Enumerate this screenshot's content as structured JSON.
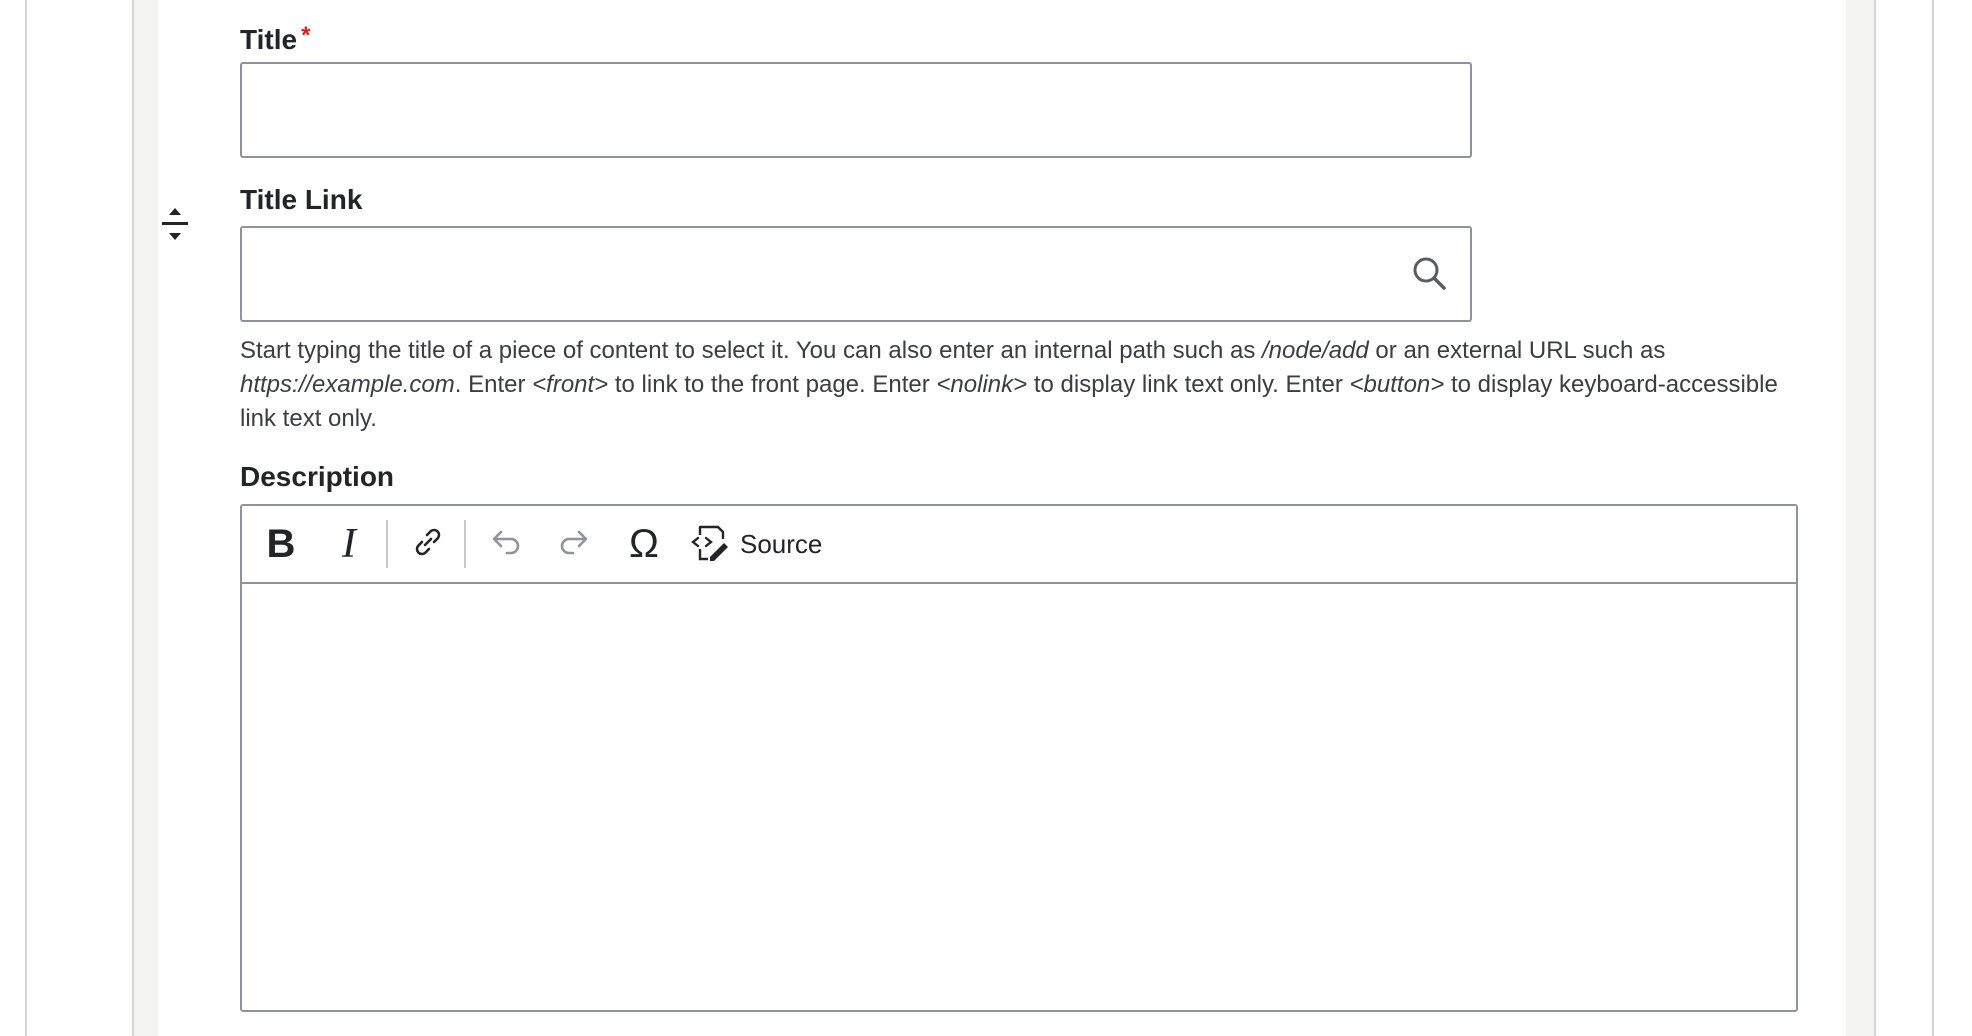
{
  "fields": {
    "title": {
      "label": "Title",
      "required_marker": "*",
      "value": ""
    },
    "title_link": {
      "label": "Title Link",
      "value": ""
    },
    "help": {
      "p1": "Start typing the title of a piece of content to select it. You can also enter an internal path such as ",
      "e1": "/node/add",
      "p2": " or an external URL such as ",
      "e2": "https://example.com",
      "p3": ". Enter ",
      "e3": "<front>",
      "p4": " to link to the front page. Enter ",
      "e4": "<nolink>",
      "p5": " to display link text only. Enter ",
      "e5": "<button>",
      "p6": " to dis­play keyboard-accessible link text only."
    },
    "description": {
      "label": "Description",
      "toolbar": {
        "bold": "B",
        "italic": "I",
        "special_chars": "Ω",
        "source_label": "Source"
      },
      "content": ""
    }
  },
  "icons": {
    "drag": "drag-handle-icon",
    "search": "search-icon",
    "bold": "bold-icon",
    "italic": "italic-icon",
    "link": "link-icon",
    "undo": "undo-icon",
    "redo": "redo-icon",
    "special_chars": "omega-icon",
    "source": "source-icon"
  },
  "colors": {
    "required": "#d72222",
    "border": "#8e929c",
    "text": "#232429"
  }
}
